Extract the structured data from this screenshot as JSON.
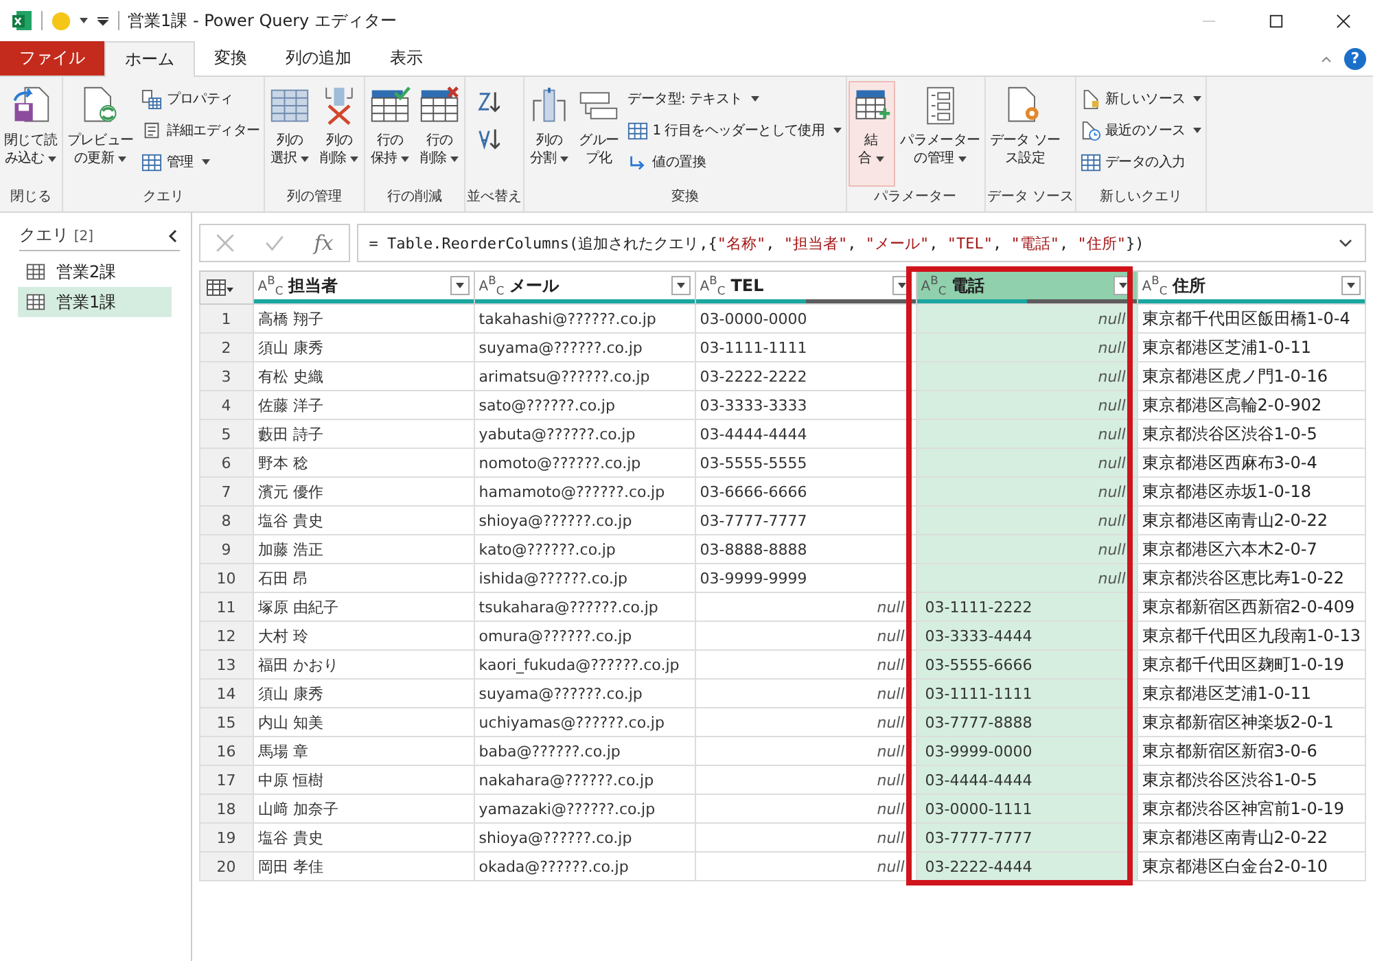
{
  "window": {
    "title": "営業1課 - Power Query エディター"
  },
  "ribbon_tabs": [
    {
      "label": "ファイル",
      "kind": "file",
      "selected": false
    },
    {
      "label": "ホーム",
      "kind": "tab",
      "selected": true
    },
    {
      "label": "変換",
      "kind": "tab",
      "selected": false
    },
    {
      "label": "列の追加",
      "kind": "tab",
      "selected": false
    },
    {
      "label": "表示",
      "kind": "tab",
      "selected": false
    }
  ],
  "help": "?",
  "ribbon_groups": [
    {
      "label": "閉じる",
      "items": [
        {
          "kind": "large",
          "lines": [
            "閉じて読",
            "み込む"
          ],
          "dropdown": true,
          "selected": false
        }
      ]
    },
    {
      "label": "クエリ",
      "items": [
        {
          "kind": "large",
          "lines": [
            "プレビュー",
            "の更新"
          ],
          "dropdown": true,
          "selected": false
        },
        {
          "kind": "small",
          "label": "プロパティ",
          "dropdown": false
        },
        {
          "kind": "small",
          "label": "詳細エディター",
          "dropdown": false
        },
        {
          "kind": "small",
          "label": "管理",
          "dropdown": true
        }
      ]
    },
    {
      "label": "列の管理",
      "items": [
        {
          "kind": "large",
          "lines": [
            "列の",
            "選択"
          ],
          "dropdown": true,
          "selected": false
        },
        {
          "kind": "large",
          "lines": [
            "列の",
            "削除"
          ],
          "dropdown": true,
          "selected": false
        }
      ]
    },
    {
      "label": "行の削減",
      "items": [
        {
          "kind": "large",
          "lines": [
            "行の",
            "保持"
          ],
          "dropdown": true,
          "selected": false
        },
        {
          "kind": "large",
          "lines": [
            "行の",
            "削除"
          ],
          "dropdown": true,
          "selected": false
        }
      ]
    },
    {
      "label": "並べ替え",
      "items": [
        {
          "kind": "icon"
        },
        {
          "kind": "icon"
        }
      ]
    },
    {
      "label": "変換",
      "items": [
        {
          "kind": "large",
          "lines": [
            "列の",
            "分割"
          ],
          "dropdown": true,
          "selected": false
        },
        {
          "kind": "large",
          "lines": [
            "グルー",
            "プ化"
          ],
          "dropdown": false,
          "selected": false
        },
        {
          "kind": "small",
          "label": "データ型: テキスト",
          "dropdown": true
        },
        {
          "kind": "small",
          "label": "1 行目をヘッダーとして使用",
          "dropdown": true
        },
        {
          "kind": "small",
          "label": "値の置換",
          "dropdown": false
        }
      ]
    },
    {
      "label": "パラメーター",
      "items": [
        {
          "kind": "large",
          "lines": [
            "結",
            "合"
          ],
          "dropdown": true,
          "selected": true
        },
        {
          "kind": "large",
          "lines": [
            "パラメーター",
            "の管理"
          ],
          "dropdown": true,
          "selected": false
        }
      ]
    },
    {
      "label": "データ ソース",
      "items": [
        {
          "kind": "large",
          "lines": [
            "データ ソー",
            "ス設定"
          ],
          "dropdown": false,
          "selected": false
        }
      ]
    },
    {
      "label": "新しいクエリ",
      "items": [
        {
          "kind": "small",
          "label": "新しいソース",
          "dropdown": true
        },
        {
          "kind": "small",
          "label": "最近のソース",
          "dropdown": true
        },
        {
          "kind": "small",
          "label": "データの入力",
          "dropdown": false
        }
      ]
    }
  ],
  "queries": {
    "title": "クエリ",
    "count": "[2]",
    "items": [
      {
        "label": "営業2課",
        "selected": false
      },
      {
        "label": "営業1課",
        "selected": true
      }
    ]
  },
  "formula": {
    "fx": "fx",
    "parts": [
      {
        "t": "= Table.ReorderColumns(追加されたクエリ,{",
        "kind": "plain"
      },
      {
        "t": "\"名称\"",
        "kind": "string"
      },
      {
        "t": ", ",
        "kind": "plain"
      },
      {
        "t": "\"担当者\"",
        "kind": "string"
      },
      {
        "t": ", ",
        "kind": "plain"
      },
      {
        "t": "\"メール\"",
        "kind": "string"
      },
      {
        "t": ", ",
        "kind": "plain"
      },
      {
        "t": "\"TEL\"",
        "kind": "string"
      },
      {
        "t": ", ",
        "kind": "plain"
      },
      {
        "t": "\"電話\"",
        "kind": "string"
      },
      {
        "t": ", ",
        "kind": "plain"
      },
      {
        "t": "\"住所\"",
        "kind": "string"
      },
      {
        "t": "})",
        "kind": "plain"
      }
    ]
  },
  "table": {
    "columns": [
      {
        "type": "A$^{B}$$_{C}$",
        "name": "担当者",
        "level": 1,
        "selected": false,
        "highlighted": false
      },
      {
        "type": "A$^{B}$$_{C}$",
        "name": "メール",
        "level": 1,
        "selected": false,
        "highlighted": false
      },
      {
        "type": "A$^{B}$$_{C}$",
        "name": "TEL",
        "level": 0.5,
        "selected": false,
        "highlighted": false
      },
      {
        "type": "A$^{B}$$_{C}$",
        "name": "電話",
        "level": 0.5,
        "selected": true,
        "highlighted": true
      },
      {
        "type": "A$^{B}$$_{C}$",
        "name": "住所",
        "level": 1,
        "selected": false,
        "highlighted": false
      }
    ],
    "rows": [
      {
        "n": "1",
        "cells": [
          {
            "t": "高橋 翔子"
          },
          {
            "t": "takahashi@??????.co.jp"
          },
          {
            "t": "03-0000-0000"
          },
          {
            "t": "null",
            "kind": "null"
          },
          {
            "t": "東京都千代田区飯田橋1-0-4"
          }
        ]
      },
      {
        "n": "2",
        "cells": [
          {
            "t": "須山 康秀"
          },
          {
            "t": "suyama@??????.co.jp"
          },
          {
            "t": "03-1111-1111"
          },
          {
            "t": "null",
            "kind": "null"
          },
          {
            "t": "東京都港区芝浦1-0-11"
          }
        ]
      },
      {
        "n": "3",
        "cells": [
          {
            "t": "有松 史織"
          },
          {
            "t": "arimatsu@??????.co.jp"
          },
          {
            "t": "03-2222-2222"
          },
          {
            "t": "null",
            "kind": "null"
          },
          {
            "t": "東京都港区虎ノ門1-0-16"
          }
        ]
      },
      {
        "n": "4",
        "cells": [
          {
            "t": "佐藤 洋子"
          },
          {
            "t": "sato@??????.co.jp"
          },
          {
            "t": "03-3333-3333"
          },
          {
            "t": "null",
            "kind": "null"
          },
          {
            "t": "東京都港区高輪2-0-902"
          }
        ]
      },
      {
        "n": "5",
        "cells": [
          {
            "t": "藪田 詩子"
          },
          {
            "t": "yabuta@??????.co.jp"
          },
          {
            "t": "03-4444-4444"
          },
          {
            "t": "null",
            "kind": "null"
          },
          {
            "t": "東京都渋谷区渋谷1-0-5"
          }
        ]
      },
      {
        "n": "6",
        "cells": [
          {
            "t": "野本 稔"
          },
          {
            "t": "nomoto@??????.co.jp"
          },
          {
            "t": "03-5555-5555"
          },
          {
            "t": "null",
            "kind": "null"
          },
          {
            "t": "東京都港区西麻布3-0-4"
          }
        ]
      },
      {
        "n": "7",
        "cells": [
          {
            "t": "濱元 優作"
          },
          {
            "t": "hamamoto@??????.co.jp"
          },
          {
            "t": "03-6666-6666"
          },
          {
            "t": "null",
            "kind": "null"
          },
          {
            "t": "東京都港区赤坂1-0-18"
          }
        ]
      },
      {
        "n": "8",
        "cells": [
          {
            "t": "塩谷 貴史"
          },
          {
            "t": "shioya@??????.co.jp"
          },
          {
            "t": "03-7777-7777"
          },
          {
            "t": "null",
            "kind": "null"
          },
          {
            "t": "東京都港区南青山2-0-22"
          }
        ]
      },
      {
        "n": "9",
        "cells": [
          {
            "t": "加藤 浩正"
          },
          {
            "t": "kato@??????.co.jp"
          },
          {
            "t": "03-8888-8888"
          },
          {
            "t": "null",
            "kind": "null"
          },
          {
            "t": "東京都港区六本木2-0-7"
          }
        ]
      },
      {
        "n": "10",
        "cells": [
          {
            "t": "石田 昂"
          },
          {
            "t": "ishida@??????.co.jp"
          },
          {
            "t": "03-9999-9999"
          },
          {
            "t": "null",
            "kind": "null"
          },
          {
            "t": "東京都渋谷区恵比寿1-0-22"
          }
        ]
      },
      {
        "n": "11",
        "cells": [
          {
            "t": "塚原 由紀子"
          },
          {
            "t": "tsukahara@??????.co.jp"
          },
          {
            "t": "null",
            "kind": "null"
          },
          {
            "t": "03-1111-2222"
          },
          {
            "t": "東京都新宿区西新宿2-0-409"
          }
        ]
      },
      {
        "n": "12",
        "cells": [
          {
            "t": "大村 玲"
          },
          {
            "t": "omura@??????.co.jp"
          },
          {
            "t": "null",
            "kind": "null"
          },
          {
            "t": "03-3333-4444"
          },
          {
            "t": "東京都千代田区九段南1-0-13"
          }
        ]
      },
      {
        "n": "13",
        "cells": [
          {
            "t": "福田 かおり"
          },
          {
            "t": "kaori_fukuda@??????.co.jp"
          },
          {
            "t": "null",
            "kind": "null"
          },
          {
            "t": "03-5555-6666"
          },
          {
            "t": "東京都千代田区麹町1-0-19"
          }
        ]
      },
      {
        "n": "14",
        "cells": [
          {
            "t": "須山 康秀"
          },
          {
            "t": "suyama@??????.co.jp"
          },
          {
            "t": "null",
            "kind": "null"
          },
          {
            "t": "03-1111-1111"
          },
          {
            "t": "東京都港区芝浦1-0-11"
          }
        ]
      },
      {
        "n": "15",
        "cells": [
          {
            "t": "内山 知美"
          },
          {
            "t": "uchiyamas@??????.co.jp"
          },
          {
            "t": "null",
            "kind": "null"
          },
          {
            "t": "03-7777-8888"
          },
          {
            "t": "東京都新宿区神楽坂2-0-1"
          }
        ]
      },
      {
        "n": "16",
        "cells": [
          {
            "t": "馬場 章"
          },
          {
            "t": "baba@??????.co.jp"
          },
          {
            "t": "null",
            "kind": "null"
          },
          {
            "t": "03-9999-0000"
          },
          {
            "t": "東京都新宿区新宿3-0-6"
          }
        ]
      },
      {
        "n": "17",
        "cells": [
          {
            "t": "中原 恒樹"
          },
          {
            "t": "nakahara@??????.co.jp"
          },
          {
            "t": "null",
            "kind": "null"
          },
          {
            "t": "03-4444-4444"
          },
          {
            "t": "東京都渋谷区渋谷1-0-5"
          }
        ]
      },
      {
        "n": "18",
        "cells": [
          {
            "t": "山﨑 加奈子"
          },
          {
            "t": "yamazaki@??????.co.jp"
          },
          {
            "t": "null",
            "kind": "null"
          },
          {
            "t": "03-0000-1111"
          },
          {
            "t": "東京都渋谷区神宮前1-0-19"
          }
        ]
      },
      {
        "n": "19",
        "cells": [
          {
            "t": "塩谷 貴史"
          },
          {
            "t": "shioya@??????.co.jp"
          },
          {
            "t": "null",
            "kind": "null"
          },
          {
            "t": "03-7777-7777"
          },
          {
            "t": "東京都港区南青山2-0-22"
          }
        ]
      },
      {
        "n": "20",
        "cells": [
          {
            "t": "岡田 孝佳"
          },
          {
            "t": "okada@??????.co.jp"
          },
          {
            "t": "null",
            "kind": "null"
          },
          {
            "t": "03-2222-4444"
          },
          {
            "t": "東京都港区白金台2-0-10"
          }
        ]
      }
    ]
  }
}
